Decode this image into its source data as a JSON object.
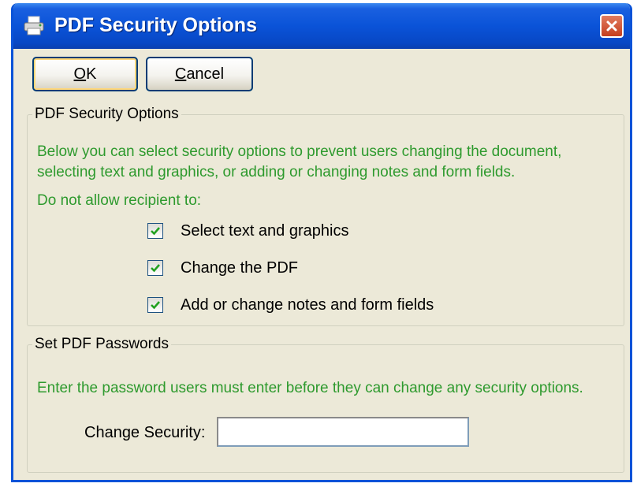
{
  "window": {
    "title": "PDF Security Options",
    "close_icon": "close-icon",
    "title_icon": "printer-icon"
  },
  "buttons": {
    "ok_label": "OK",
    "cancel_label": "Cancel"
  },
  "security_group": {
    "legend": "PDF Security Options",
    "description_line1": "Below you can select security options to prevent users changing the document,",
    "description_line2": "selecting text and graphics, or adding or changing notes and form fields.",
    "restrict_label": "Do not allow recipient to:",
    "options": [
      {
        "label": "Select text and graphics",
        "checked": true
      },
      {
        "label": "Change the PDF",
        "checked": true
      },
      {
        "label": "Add or change notes and form fields",
        "checked": true
      }
    ]
  },
  "password_group": {
    "legend": "Set PDF Passwords",
    "description": "Enter the password users must enter before they can change any security options.",
    "change_security_label": "Change Security:",
    "change_security_value": ""
  },
  "colors": {
    "titlebar": "#0a53d8",
    "info_text": "#2e9a2e",
    "dialog_bg": "#ece9d8",
    "checkmark": "#21a121"
  }
}
